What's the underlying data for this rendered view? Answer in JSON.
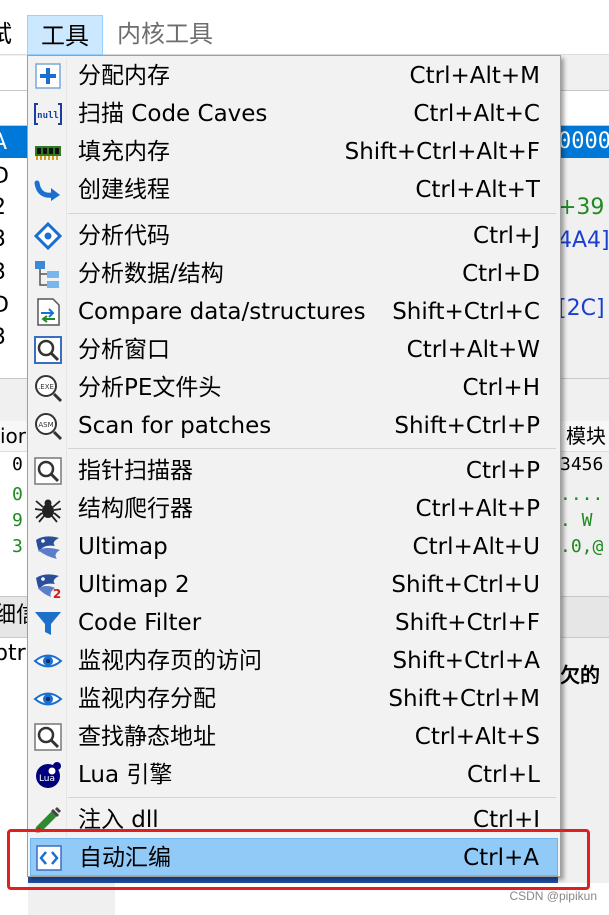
{
  "menubar": {
    "cut_label": "试",
    "tools_label": "工具",
    "kernel_label": "内核工具"
  },
  "background": {
    "selected_row_text": "0000",
    "left_letters": [
      "A",
      "D",
      "2",
      "3",
      "3",
      "D",
      "3"
    ],
    "code_lines": [
      "+39",
      "4A4]",
      "[2C]"
    ],
    "header_left": "ior",
    "header_right": "模块",
    "hex_rows": [
      {
        "left": "0",
        "right": "3456"
      },
      {
        "left": "0",
        "right": "...."
      },
      {
        "left": "9",
        "right": ".  W"
      },
      {
        "left": "3",
        "right": ".0,@"
      }
    ],
    "panel2_left": "细信",
    "panel2_left2": "ptr",
    "side_text": "欠的",
    "watermark": "CSDN @pipikun"
  },
  "menu": {
    "items": [
      {
        "label": "分配内存",
        "shortcut": "Ctrl+Alt+M",
        "icon": "plus-icon"
      },
      {
        "label": "扫描 Code Caves",
        "shortcut": "Ctrl+Alt+C",
        "icon": "null-bracket-icon"
      },
      {
        "label": "填充内存",
        "shortcut": "Shift+Ctrl+Alt+F",
        "icon": "memory-chip-icon"
      },
      {
        "label": "创建线程",
        "shortcut": "Ctrl+Alt+T",
        "icon": "curved-arrow-icon"
      },
      {
        "label": "分析代码",
        "shortcut": "Ctrl+J",
        "icon": "code-diamond-icon"
      },
      {
        "label": "分析数据/结构",
        "shortcut": "Ctrl+D",
        "icon": "tree-structure-icon"
      },
      {
        "label": "Compare data/structures",
        "shortcut": "Shift+Ctrl+C",
        "icon": "compare-docs-icon"
      },
      {
        "label": "分析窗口",
        "shortcut": "Ctrl+Alt+W",
        "icon": "window-magnifier-icon"
      },
      {
        "label": "分析PE文件头",
        "shortcut": "Ctrl+H",
        "icon": "exe-magnifier-icon"
      },
      {
        "label": "Scan for patches",
        "shortcut": "Shift+Ctrl+P",
        "icon": "asm-magnifier-icon"
      },
      {
        "label": "指针扫描器",
        "shortcut": "Ctrl+P",
        "icon": "pointer-magnifier-icon"
      },
      {
        "label": "结构爬行器",
        "shortcut": "Ctrl+Alt+P",
        "icon": "spider-icon"
      },
      {
        "label": "Ultimap",
        "shortcut": "Ctrl+Alt+U",
        "icon": "ultimap-icon"
      },
      {
        "label": "Ultimap 2",
        "shortcut": "Shift+Ctrl+U",
        "icon": "ultimap2-icon"
      },
      {
        "label": "Code Filter",
        "shortcut": "Shift+Ctrl+F",
        "icon": "funnel-icon"
      },
      {
        "label": "监视内存页的访问",
        "shortcut": "Shift+Ctrl+A",
        "icon": "eye-icon"
      },
      {
        "label": "监视内存分配",
        "shortcut": "Shift+Ctrl+M",
        "icon": "eye-icon"
      },
      {
        "label": "查找静态地址",
        "shortcut": "Ctrl+Alt+S",
        "icon": "static-magnifier-icon"
      },
      {
        "label": "Lua 引擎",
        "shortcut": "Ctrl+L",
        "icon": "lua-icon"
      },
      {
        "label": "注入 dll",
        "shortcut": "Ctrl+I",
        "icon": "syringe-icon"
      },
      {
        "label": "自动汇编",
        "shortcut": "Ctrl+A",
        "icon": "auto-assemble-icon"
      }
    ]
  },
  "colors": {
    "selection": "#91c9f7",
    "menubar_highlight": "#cce8ff",
    "annotation": "#e02020",
    "code_green": "#1f8a1f",
    "code_blue": "#1a3fd0"
  }
}
